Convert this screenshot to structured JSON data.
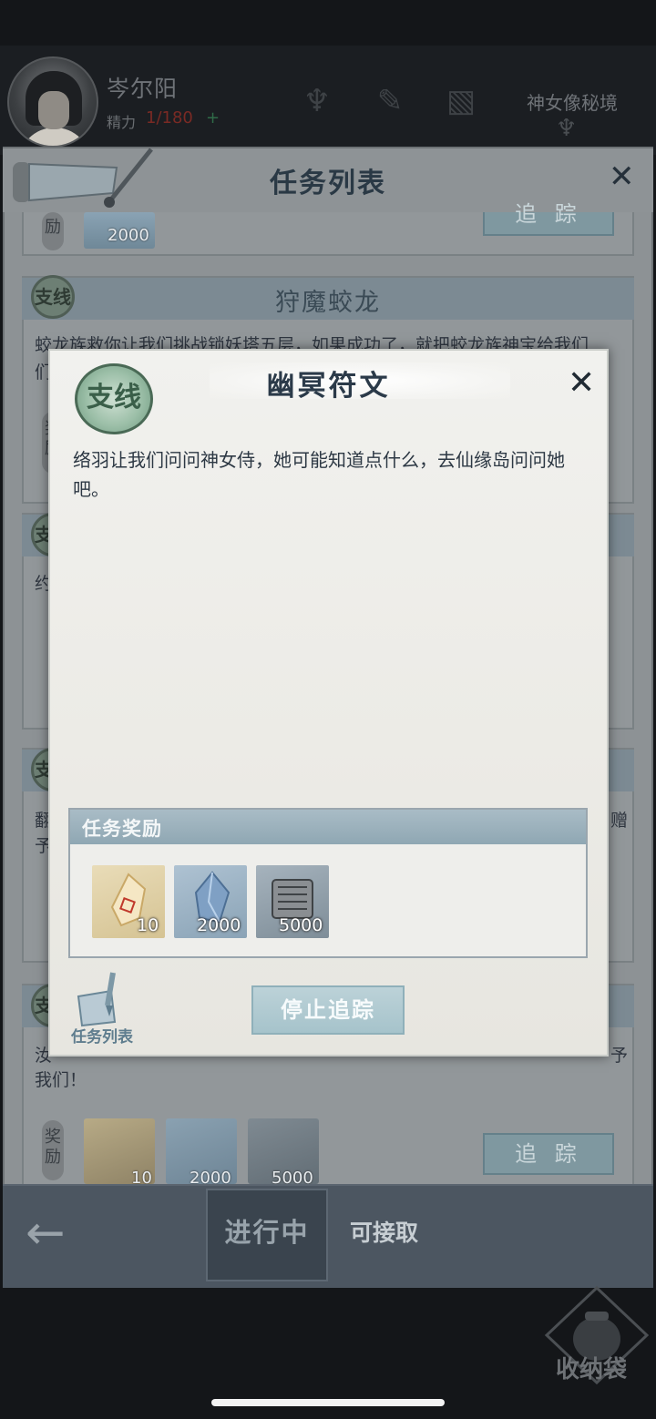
{
  "hud": {
    "player_name": "岑尔阳",
    "energy_label": "精力",
    "energy_value": "1/180",
    "energy_plus": "+",
    "secret_realm_label": "神女像秘境"
  },
  "task_list": {
    "title": "任务列表",
    "cards": [
      {
        "reward_tag": "励",
        "rewards": [
          {
            "icon": "spirit-crystal-icon",
            "count": "2000"
          }
        ],
        "track_label": "追 踪"
      },
      {
        "title": "狩魔蛟龙",
        "badge": "支线",
        "body": "蛟龙族救你让我们挑战锁妖塔五层，如果成功了，就把蛟龙族神宝给我们",
        "body_line2": "们",
        "reward_tag": "奖励"
      },
      {
        "badge": "支线",
        "body": "约"
      },
      {
        "badge": "支线",
        "body": "翻",
        "body_line2": "予",
        "body_right": "赠"
      },
      {
        "badge": "支线",
        "body": "汝",
        "body_right": "予",
        "body_line2": "我们！",
        "reward_tag": "奖励",
        "rewards": [
          {
            "icon": "gold-gem-icon",
            "count": "10"
          },
          {
            "icon": "spirit-crystal-icon",
            "count": "2000"
          },
          {
            "icon": "scroll-bundle-icon",
            "count": "5000"
          }
        ],
        "track_label": "追 踪"
      }
    ]
  },
  "tabs": {
    "in_progress": "进行中",
    "available": "可接取"
  },
  "bag_label": "收纳袋",
  "modal": {
    "badge": "支线",
    "title": "幽冥符文",
    "description": "络羽让我们问问神女侍，她可能知道点什么，去仙缘岛问问她吧。",
    "reward_header": "任务奖励",
    "rewards": [
      {
        "icon": "gold-gem-icon",
        "count": "10"
      },
      {
        "icon": "spirit-crystal-icon",
        "count": "2000"
      },
      {
        "icon": "scroll-bundle-icon",
        "count": "5000"
      }
    ],
    "stop_tracking_label": "停止追踪",
    "task_list_label": "任务列表"
  }
}
